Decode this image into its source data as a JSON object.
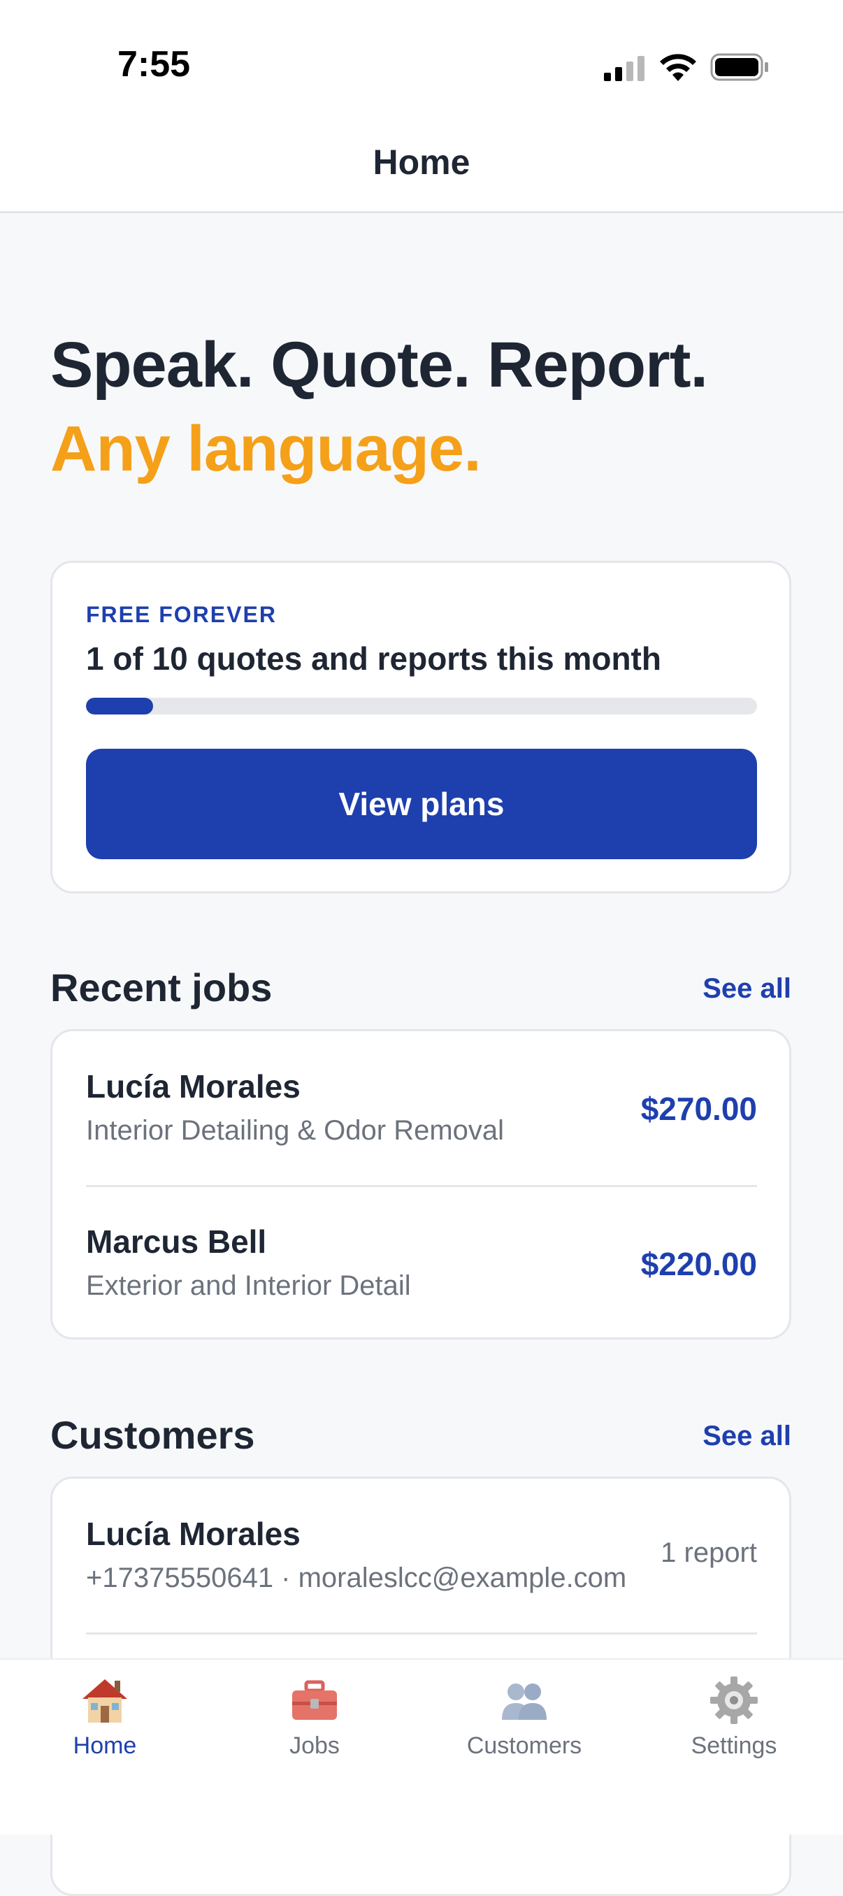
{
  "status_bar": {
    "time": "7:55"
  },
  "header": {
    "title": "Home"
  },
  "hero": {
    "line1": "Speak. Quote. Report.",
    "line2": "Any language."
  },
  "plan": {
    "tier": "FREE FOREVER",
    "usage_text": "1 of 10 quotes and reports this month",
    "progress_fraction": 0.1,
    "button_label": "View plans"
  },
  "recent_jobs": {
    "title": "Recent jobs",
    "see_all": "See all",
    "items": [
      {
        "name": "Lucía Morales",
        "service": "Interior Detailing & Odor Removal",
        "amount": "$270.00"
      },
      {
        "name": "Marcus Bell",
        "service": "Exterior and Interior Detail",
        "amount": "$220.00"
      }
    ]
  },
  "customers": {
    "title": "Customers",
    "see_all": "See all",
    "items": [
      {
        "name": "Lucía Morales",
        "contact": "+17375550641 · moraleslcc@example.com",
        "reports": "1 report"
      }
    ]
  },
  "tabs": [
    {
      "label": "Home",
      "icon": "house-icon",
      "active": true
    },
    {
      "label": "Jobs",
      "icon": "toolbox-icon",
      "active": false
    },
    {
      "label": "Customers",
      "icon": "people-icon",
      "active": false
    },
    {
      "label": "Settings",
      "icon": "gear-icon",
      "active": false
    }
  ],
  "colors": {
    "accent": "#1e3fae",
    "highlight": "#f5a019",
    "text": "#1f2633",
    "muted": "#6c727c",
    "background": "#f7f8fa"
  }
}
